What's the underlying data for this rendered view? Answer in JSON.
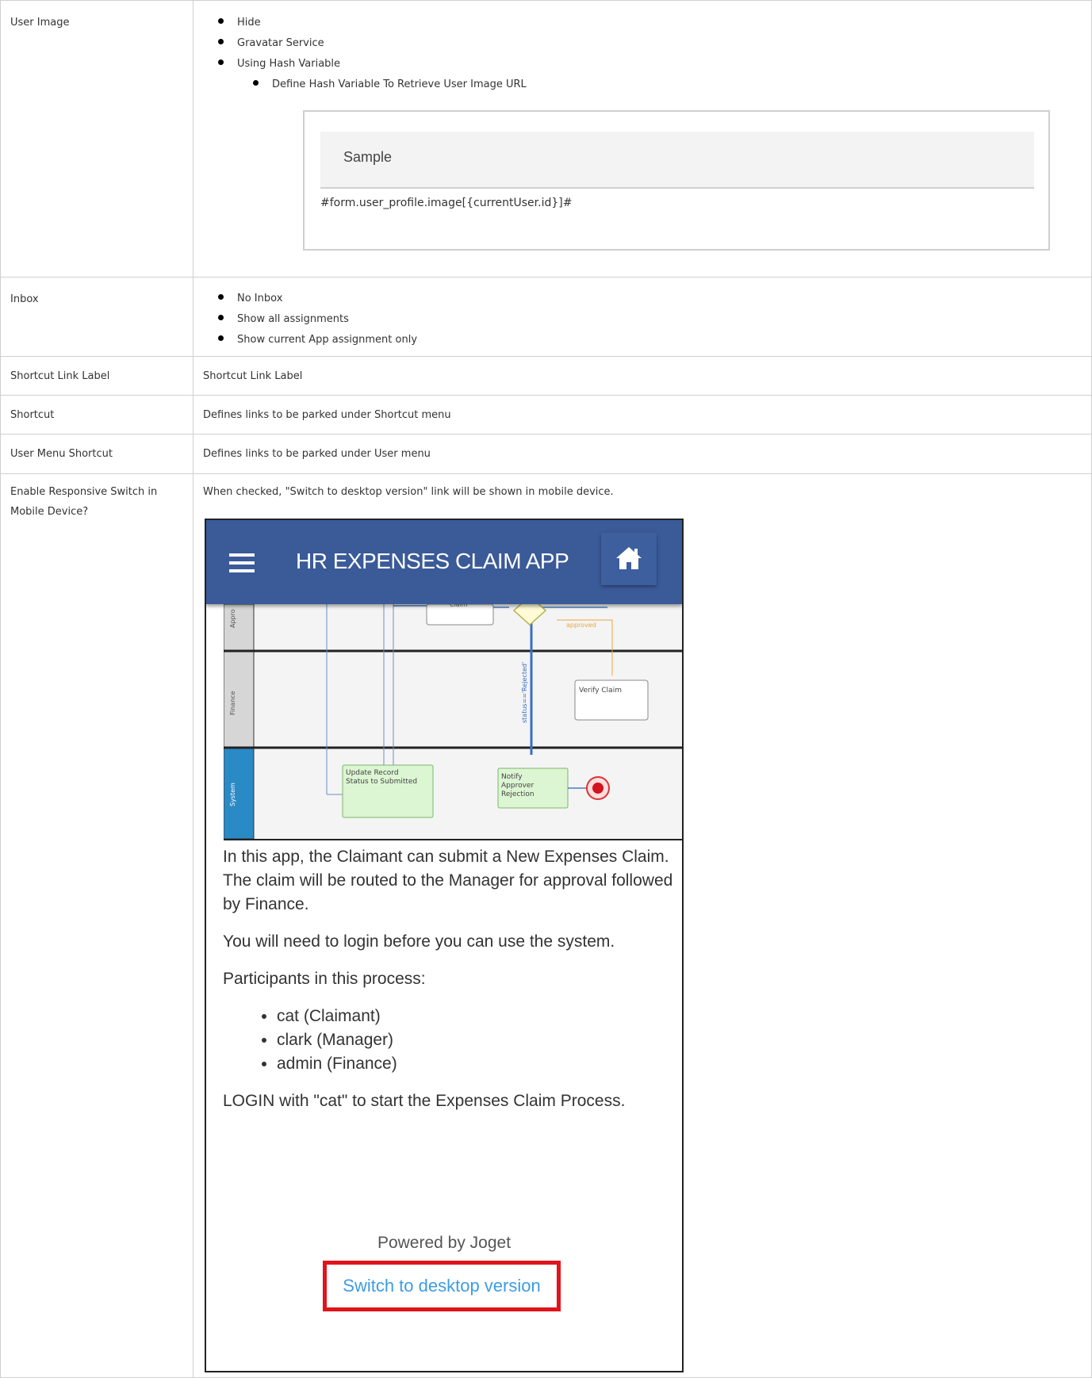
{
  "rows": [
    {
      "key": "User Image",
      "options": [
        "Hide",
        "Gravatar Service",
        "Using Hash Variable"
      ],
      "sub_options": [
        "Define Hash Variable To Retrieve User Image URL"
      ],
      "sample": {
        "title": "Sample",
        "code": "#form.user_profile.image[{currentUser.id}]#"
      }
    },
    {
      "key": "Inbox",
      "options": [
        "No Inbox",
        "Show all assignments",
        "Show current App assignment only"
      ]
    },
    {
      "key": "Shortcut Link Label",
      "value": "Shortcut Link Label"
    },
    {
      "key": "Shortcut",
      "value": "Defines links to be parked under Shortcut menu"
    },
    {
      "key": "User Menu Shortcut",
      "value": "Defines links to be parked under User menu"
    },
    {
      "key": "Enable Responsive Switch in Mobile Device?",
      "value": "When checked, \"Switch to desktop version\" link will be shown in mobile device."
    }
  ],
  "mobile": {
    "app_title": "HR EXPENSES CLAIM APP",
    "hamburger_icon": "menu-icon",
    "home_icon": "home-icon",
    "diagram": {
      "lanes": [
        "Approver",
        "Finance",
        "System"
      ],
      "nodes": [
        "Claim",
        "Verify Claim",
        "Update Record Status to Submitted",
        "Notify Approver Rejection"
      ],
      "edge_labels": [
        "approved",
        "status=='Rejected'"
      ]
    },
    "paragraphs": [
      "In this app, the Claimant can submit a New Expenses Claim. The claim will be routed to the Manager for approval followed by Finance.",
      "You will need to login before you can use the system.",
      "Participants in this process:"
    ],
    "participants": [
      "cat (Claimant)",
      "clark (Manager)",
      "admin (Finance)"
    ],
    "login_text": "LOGIN with \"cat\" to start the Expenses Claim Process.",
    "powered_by": "Powered by Joget",
    "switch_link": "Switch to desktop version",
    "highlight_color": "#e0141c",
    "header_color": "#3a5a98"
  }
}
